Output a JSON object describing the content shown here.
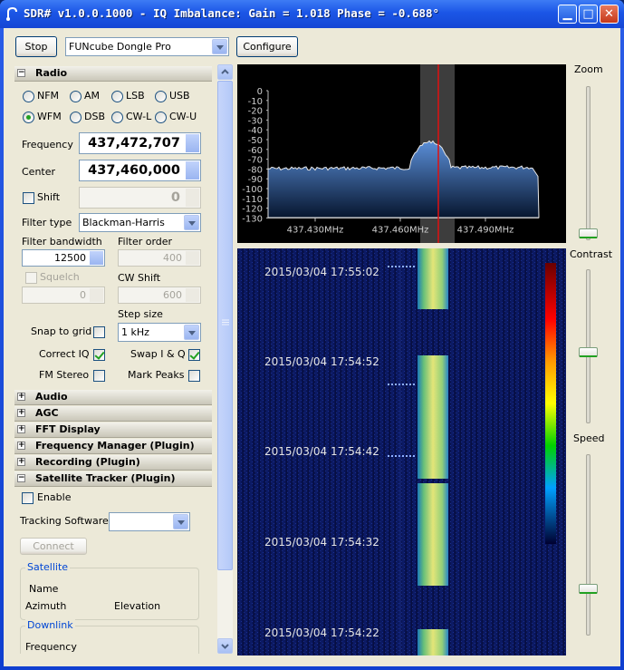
{
  "window": {
    "title": "SDR# v1.0.0.1000 - IQ Imbalance: Gain = 1.018 Phase = -0.688°"
  },
  "toolbar": {
    "stop_label": "Stop",
    "device": "FUNcube Dongle Pro",
    "configure_label": "Configure"
  },
  "radio": {
    "header": "Radio",
    "modes_row1": [
      "NFM",
      "AM",
      "LSB",
      "USB"
    ],
    "modes_row2": [
      "WFM",
      "DSB",
      "CW-L",
      "CW-U"
    ],
    "selected_mode": "WFM",
    "frequency_label": "Frequency",
    "frequency": "437,472,707",
    "center_label": "Center",
    "center": "437,460,000",
    "shift_label": "Shift",
    "shift": "0",
    "filter_type_label": "Filter type",
    "filter_type": "Blackman-Harris",
    "filter_bandwidth_label": "Filter bandwidth",
    "filter_bandwidth": "12500",
    "filter_order_label": "Filter order",
    "filter_order": "400",
    "squelch_label": "Squelch",
    "squelch": "0",
    "cw_shift_label": "CW Shift",
    "cw_shift": "600",
    "step_size_label": "Step size",
    "step_size": "1 kHz",
    "snap_label": "Snap to grid",
    "correct_iq_label": "Correct IQ",
    "swap_iq_label": "Swap I & Q",
    "fm_stereo_label": "FM Stereo",
    "mark_peaks_label": "Mark Peaks"
  },
  "sections": [
    "Audio",
    "AGC",
    "FFT Display",
    "Frequency Manager (Plugin)",
    "Recording (Plugin)",
    "Satellite Tracker (Plugin)"
  ],
  "sat": {
    "enable_label": "Enable",
    "tracking_label": "Tracking Software",
    "connect_label": "Connect",
    "satellite_group": "Satellite",
    "name_label": "Name",
    "azimuth_label": "Azimuth",
    "elevation_label": "Elevation",
    "downlink_group": "Downlink",
    "frequency_label": "Frequency"
  },
  "spectrum": {
    "db_ticks": [
      "0",
      "-10",
      "-20",
      "-30",
      "-40",
      "-50",
      "-60",
      "-70",
      "-80",
      "-90",
      "-100",
      "-110",
      "-120",
      "-130"
    ],
    "freq_ticks": [
      "437.430MHz",
      "437.460MHz",
      "437.490MHz"
    ]
  },
  "waterfall": {
    "timestamps": [
      "2015/03/04 17:55:02",
      "2015/03/04 17:54:52",
      "2015/03/04 17:54:42",
      "2015/03/04 17:54:32",
      "2015/03/04 17:54:22"
    ]
  },
  "right": {
    "zoom_label": "Zoom",
    "contrast_label": "Contrast",
    "speed_label": "Speed"
  }
}
